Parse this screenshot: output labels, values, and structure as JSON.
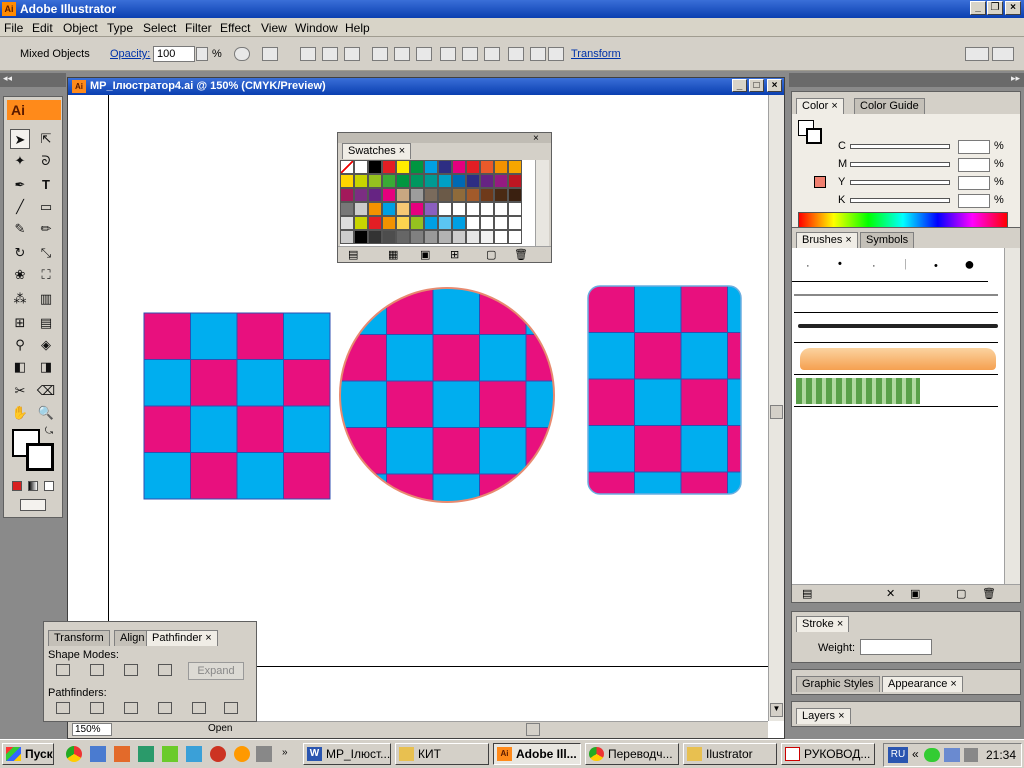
{
  "app": {
    "title": "Adobe Illustrator"
  },
  "menu": [
    "File",
    "Edit",
    "Object",
    "Type",
    "Select",
    "Filter",
    "Effect",
    "View",
    "Window",
    "Help"
  ],
  "control": {
    "selection": "Mixed Objects",
    "opacity_label": "Opacity:",
    "opacity_value": "100",
    "percent": "%",
    "transform_label": "Transform"
  },
  "document": {
    "title": "MP_Ілюстратор4.ai @ 150% (CMYK/Preview)",
    "zoom": "150%",
    "status": "Open"
  },
  "tools": {
    "badge": "Ai"
  },
  "swatches": {
    "tab": "Swatches"
  },
  "colors": {
    "magenta": "#e8107e",
    "cyan": "#00aeef",
    "grid": "#2f4fb0",
    "accent": "#ff8a1a"
  },
  "color_panel": {
    "tabs": [
      "Color",
      "Color Guide"
    ],
    "channels": [
      "C",
      "M",
      "Y",
      "K"
    ],
    "percent": "%"
  },
  "brushes_panel": {
    "tabs": [
      "Brushes",
      "Symbols"
    ]
  },
  "stroke_panel": {
    "tab": "Stroke",
    "weight_label": "Weight:"
  },
  "styles_panel": {
    "tabs": [
      "Graphic Styles",
      "Appearance"
    ]
  },
  "layers_panel": {
    "tab": "Layers"
  },
  "pathfinder_panel": {
    "tabs": [
      "Transform",
      "Align",
      "Pathfinder"
    ],
    "shape_modes": "Shape Modes:",
    "expand": "Expand",
    "pathfinders": "Pathfinders:"
  },
  "taskbar": {
    "start": "Пуск",
    "items": [
      "MP_Ілюст...",
      "КИТ",
      "Adobe Ill...",
      "Переводч...",
      "Ilustrator",
      "РУКОВОД..."
    ],
    "lang": "RU",
    "clock": "21:34"
  }
}
